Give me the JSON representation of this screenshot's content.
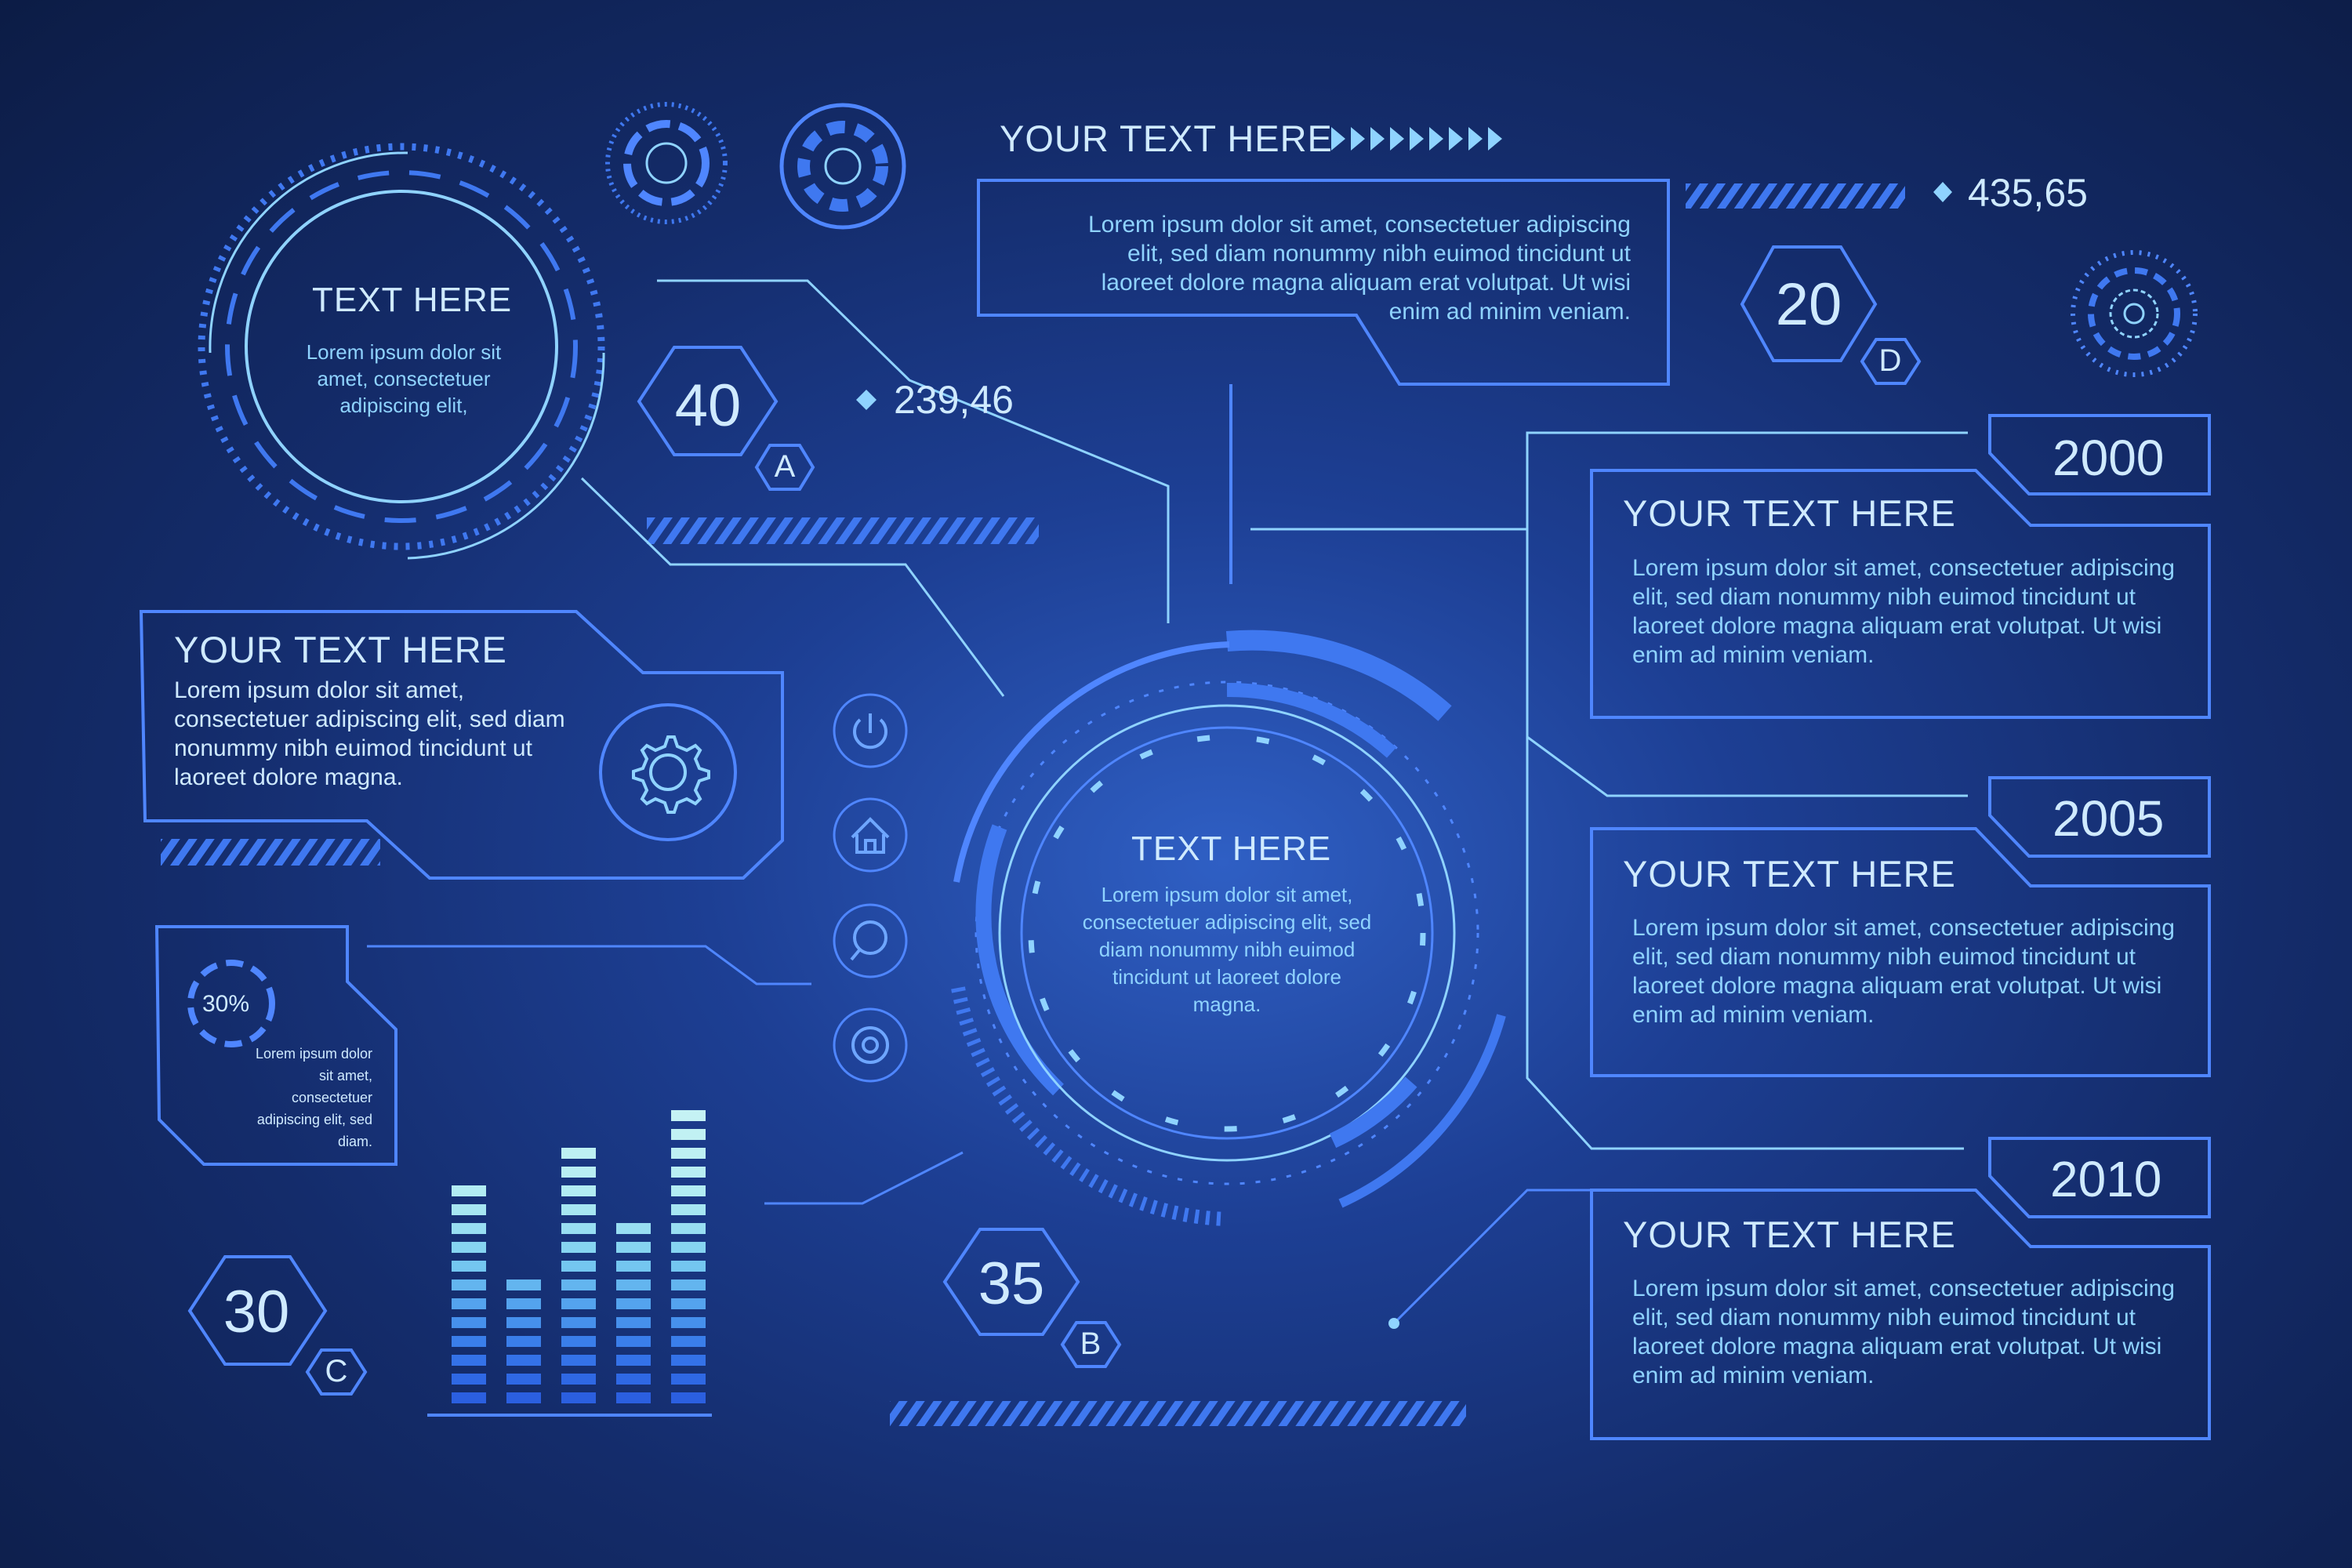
{
  "top_title": "YOUR TEXT HERE",
  "top_box_text": "Lorem ipsum dolor sit amet, consectetuer adipiscing elit, sed diam nonummy nibh euimod tincidunt ut laoreet dolore magna aliquam erat volutpat. Ut wisi enim ad minim veniam.",
  "readout_top": "435,65",
  "readout_left": "239,46",
  "circle_top_left": {
    "title": "TEXT HERE",
    "text": "Lorem ipsum dolor sit amet, consectetuer adipiscing elit,"
  },
  "left_panel": {
    "title": "YOUR TEXT HERE",
    "text": "Lorem ipsum dolor sit amet, consectetuer adipiscing elit, sed diam nonummy nibh euimod tincidunt ut laoreet dolore magna."
  },
  "center": {
    "title": "TEXT HERE",
    "text": "Lorem ipsum dolor sit amet, consectetuer adipiscing elit, sed diam nonummy nibh euimod tincidunt ut laoreet dolore magna."
  },
  "small_panel": {
    "percent_label": "30%",
    "percent": 0.3,
    "text": "Lorem ipsum dolor sit amet, consectetuer adipiscing elit, sed diam."
  },
  "hex_badges": [
    {
      "value": "40",
      "letter": "A"
    },
    {
      "value": "35",
      "letter": "B"
    },
    {
      "value": "30",
      "letter": "C"
    },
    {
      "value": "20",
      "letter": "D"
    }
  ],
  "timeline": [
    {
      "year": "2000",
      "title": "YOUR TEXT HERE",
      "text": "Lorem ipsum dolor sit amet, consectetuer adipiscing elit, sed diam nonummy nibh euimod tincidunt ut laoreet dolore magna aliquam erat volutpat. Ut wisi enim ad minim veniam."
    },
    {
      "year": "2005",
      "title": "YOUR TEXT HERE",
      "text": "Lorem ipsum dolor sit amet, consectetuer adipiscing elit, sed diam nonummy nibh euimod tincidunt ut laoreet dolore magna aliquam erat volutpat. Ut wisi enim ad minim veniam."
    },
    {
      "year": "2010",
      "title": "YOUR TEXT HERE",
      "text": "Lorem ipsum dolor sit amet, consectetuer adipiscing elit, sed diam nonummy nibh euimod tincidunt ut laoreet dolore magna aliquam erat volutpat. Ut wisi enim ad minim veniam."
    }
  ],
  "side_icons": [
    "power-icon",
    "home-icon",
    "search-icon",
    "target-icon"
  ],
  "bar_levels": [
    12,
    7,
    14,
    10,
    16
  ],
  "colors": {
    "line": "#4f86ff",
    "cyan": "#8fd3ff",
    "text": "#cfeaff",
    "bright": "#3f78f0"
  }
}
